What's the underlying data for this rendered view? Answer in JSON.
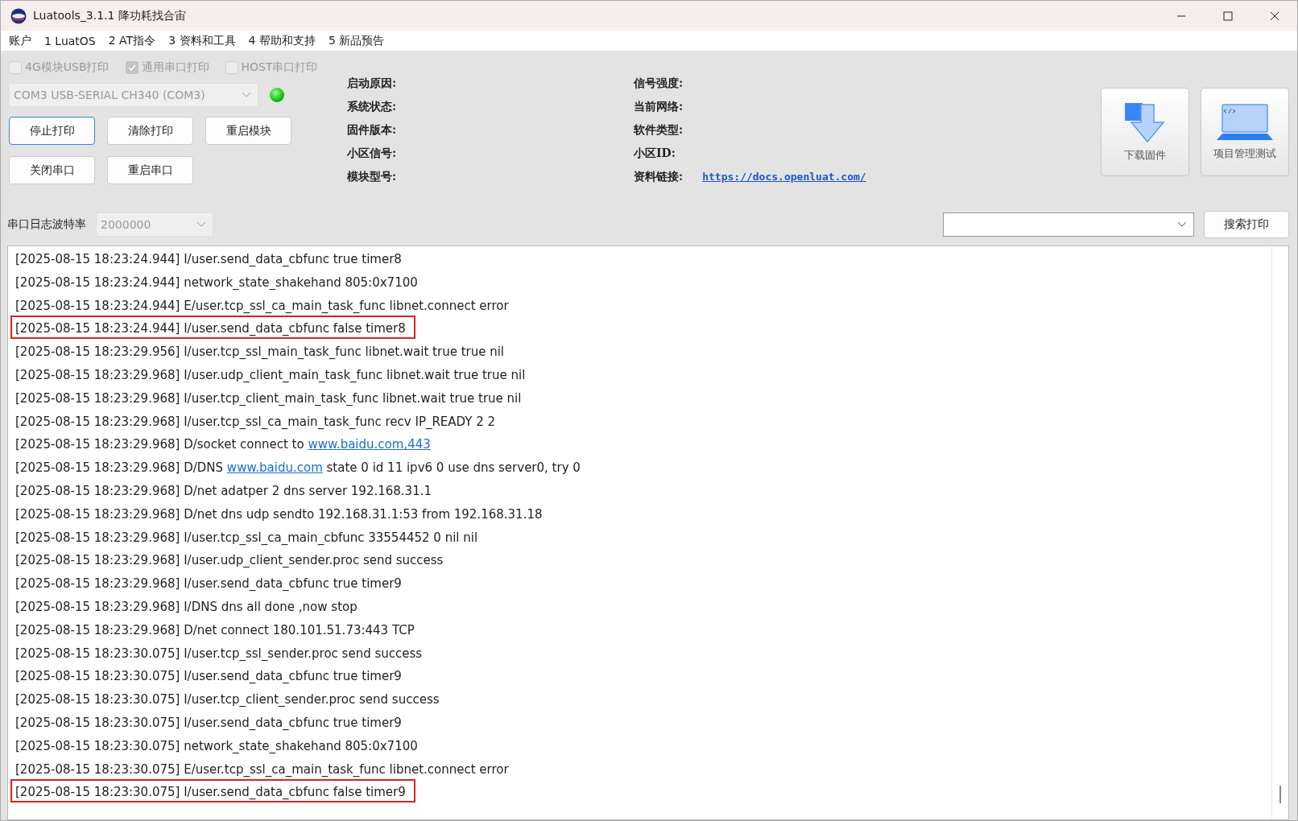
{
  "window": {
    "title": "Luatools_3.1.1 降功耗找合宙"
  },
  "menu": [
    "账户",
    "1 LuatOS",
    "2 AT指令",
    "3 资料和工具",
    "4 帮助和支持",
    "5 新品预告"
  ],
  "print_options": [
    {
      "label": "4G模块USB打印",
      "checked": false,
      "disabled": true
    },
    {
      "label": "通用串口打印",
      "checked": true,
      "disabled": true
    },
    {
      "label": "HOST串口打印",
      "checked": false,
      "disabled": true
    }
  ],
  "port": {
    "value": "COM3 USB-SERIAL CH340 (COM3)",
    "connected": true
  },
  "buttons": [
    {
      "label": "停止打印",
      "selected": true
    },
    {
      "label": "清除打印",
      "selected": false
    },
    {
      "label": "重启模块",
      "selected": false
    },
    {
      "label": "关闭串口",
      "selected": false
    },
    {
      "label": "重启串口",
      "selected": false
    }
  ],
  "info_left": [
    "启动原因:",
    "系统状态:",
    "固件版本:",
    "小区信号:",
    "模块型号:"
  ],
  "info_right": [
    {
      "label": "信号强度:"
    },
    {
      "label": "当前网络:"
    },
    {
      "label": "软件类型:"
    },
    {
      "label": "小区ID:"
    },
    {
      "label": "资料链接:",
      "link": "https://docs.openluat.com/"
    }
  ],
  "tools": [
    {
      "kind": "download",
      "label": "下载固件"
    },
    {
      "kind": "project",
      "label": "项目管理测试"
    }
  ],
  "baud": {
    "label": "串口日志波特率",
    "value": "2000000"
  },
  "search": {
    "button": "搜索打印"
  },
  "log": [
    {
      "highlighted": false,
      "parts": [
        {
          "kind": "plain",
          "text": "[2025-08-15 18:23:24.944] I/user.send_data_cbfunc true timer8"
        }
      ]
    },
    {
      "highlighted": false,
      "parts": [
        {
          "kind": "plain",
          "text": "[2025-08-15 18:23:24.944] network_state_shakehand 805:0x7100"
        }
      ]
    },
    {
      "highlighted": false,
      "parts": [
        {
          "kind": "plain",
          "text": "[2025-08-15 18:23:24.944] E/user.tcp_ssl_ca_main_task_func libnet.connect error"
        }
      ]
    },
    {
      "highlighted": true,
      "parts": [
        {
          "kind": "plain",
          "text": "[2025-08-15 18:23:24.944] I/user.send_data_cbfunc false timer8"
        }
      ]
    },
    {
      "highlighted": false,
      "parts": [
        {
          "kind": "plain",
          "text": "[2025-08-15 18:23:29.956] I/user.tcp_ssl_main_task_func libnet.wait true true nil"
        }
      ]
    },
    {
      "highlighted": false,
      "parts": [
        {
          "kind": "plain",
          "text": "[2025-08-15 18:23:29.968] I/user.udp_client_main_task_func libnet.wait true true nil"
        }
      ]
    },
    {
      "highlighted": false,
      "parts": [
        {
          "kind": "plain",
          "text": "[2025-08-15 18:23:29.968] I/user.tcp_client_main_task_func libnet.wait true true nil"
        }
      ]
    },
    {
      "highlighted": false,
      "parts": [
        {
          "kind": "plain",
          "text": "[2025-08-15 18:23:29.968] I/user.tcp_ssl_ca_main_task_func recv IP_READY 2 2"
        }
      ]
    },
    {
      "highlighted": false,
      "parts": [
        {
          "kind": "plain",
          "text": "[2025-08-15 18:23:29.968] D/socket connect to "
        },
        {
          "kind": "link",
          "text": "www.baidu.com,443"
        }
      ]
    },
    {
      "highlighted": false,
      "parts": [
        {
          "kind": "plain",
          "text": "[2025-08-15 18:23:29.968] D/DNS "
        },
        {
          "kind": "link",
          "text": "www.baidu.com"
        },
        {
          "kind": "plain",
          "text": " state 0 id 11 ipv6 0 use dns server0, try 0"
        }
      ]
    },
    {
      "highlighted": false,
      "parts": [
        {
          "kind": "plain",
          "text": "[2025-08-15 18:23:29.968] D/net adatper 2 dns server 192.168.31.1"
        }
      ]
    },
    {
      "highlighted": false,
      "parts": [
        {
          "kind": "plain",
          "text": "[2025-08-15 18:23:29.968] D/net dns udp sendto 192.168.31.1:53 from 192.168.31.18"
        }
      ]
    },
    {
      "highlighted": false,
      "parts": [
        {
          "kind": "plain",
          "text": "[2025-08-15 18:23:29.968] I/user.tcp_ssl_ca_main_cbfunc 33554452 0 nil nil"
        }
      ]
    },
    {
      "highlighted": false,
      "parts": [
        {
          "kind": "plain",
          "text": "[2025-08-15 18:23:29.968] I/user.udp_client_sender.proc send success"
        }
      ]
    },
    {
      "highlighted": false,
      "parts": [
        {
          "kind": "plain",
          "text": "[2025-08-15 18:23:29.968] I/user.send_data_cbfunc true timer9"
        }
      ]
    },
    {
      "highlighted": false,
      "parts": [
        {
          "kind": "plain",
          "text": "[2025-08-15 18:23:29.968] I/DNS dns all done ,now stop"
        }
      ]
    },
    {
      "highlighted": false,
      "parts": [
        {
          "kind": "plain",
          "text": "[2025-08-15 18:23:29.968] D/net connect 180.101.51.73:443 TCP"
        }
      ]
    },
    {
      "highlighted": false,
      "parts": [
        {
          "kind": "plain",
          "text": "[2025-08-15 18:23:30.075] I/user.tcp_ssl_sender.proc send success"
        }
      ]
    },
    {
      "highlighted": false,
      "parts": [
        {
          "kind": "plain",
          "text": "[2025-08-15 18:23:30.075] I/user.send_data_cbfunc true timer9"
        }
      ]
    },
    {
      "highlighted": false,
      "parts": [
        {
          "kind": "plain",
          "text": "[2025-08-15 18:23:30.075] I/user.tcp_client_sender.proc send success"
        }
      ]
    },
    {
      "highlighted": false,
      "parts": [
        {
          "kind": "plain",
          "text": "[2025-08-15 18:23:30.075] I/user.send_data_cbfunc true timer9"
        }
      ]
    },
    {
      "highlighted": false,
      "parts": [
        {
          "kind": "plain",
          "text": "[2025-08-15 18:23:30.075] network_state_shakehand 805:0x7100"
        }
      ]
    },
    {
      "highlighted": false,
      "parts": [
        {
          "kind": "plain",
          "text": "[2025-08-15 18:23:30.075] E/user.tcp_ssl_ca_main_task_func libnet.connect error"
        }
      ]
    },
    {
      "highlighted": true,
      "parts": [
        {
          "kind": "plain",
          "text": "[2025-08-15 18:23:30.075] I/user.send_data_cbfunc false timer9"
        }
      ]
    }
  ]
}
